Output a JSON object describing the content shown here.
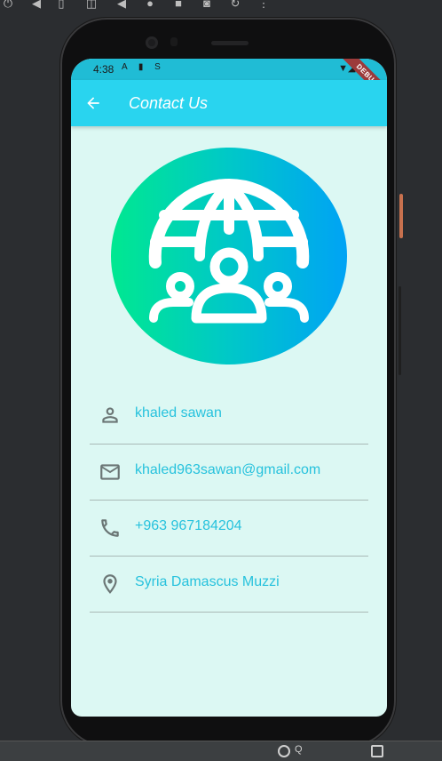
{
  "status_bar": {
    "time": "4:38",
    "left_icons": "A ▮ S",
    "right_icons": "▼◢ ◈",
    "debug_label": "DEBUG"
  },
  "app_bar": {
    "title": "Contact Us",
    "back_icon": "arrow-left-icon"
  },
  "logo": {
    "icon": "globe-people-icon",
    "gradient_colors": [
      "#00e890",
      "#00a3f5"
    ]
  },
  "contacts": [
    {
      "icon": "person-icon",
      "text": "khaled sawan"
    },
    {
      "icon": "mail-icon",
      "text": "khaled963sawan@gmail.com"
    },
    {
      "icon": "phone-icon",
      "text": "+963 967184204"
    },
    {
      "icon": "location-pin-icon",
      "text": "Syria Damascus Muzzi"
    }
  ],
  "colors": {
    "app_bar": "#29d4ef",
    "background": "#dcf8f3",
    "accent_text": "#27c2dd",
    "debug_ribbon": "#9c3b3b"
  }
}
